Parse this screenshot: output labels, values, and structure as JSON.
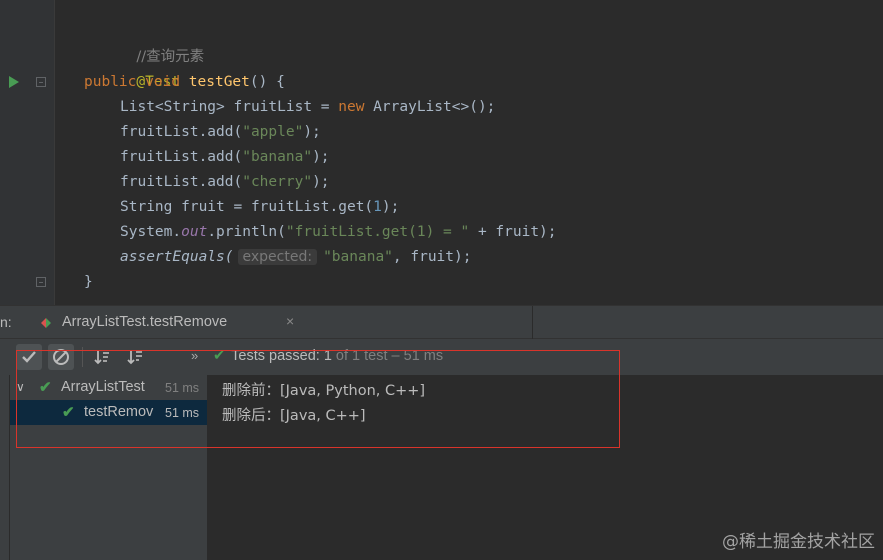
{
  "editor": {
    "comment": "//查询元素",
    "annotation": "@Test",
    "kw_public": "public",
    "kw_void": "void",
    "method_name": "testGet",
    "sig_tail": "() {",
    "l4_a": "List<String> fruitList = ",
    "kw_new": "new",
    "l4_b": " ArrayList<>();",
    "add_prefix": "fruitList.add(",
    "add_suffix": ");",
    "str_apple": "\"apple\"",
    "str_banana": "\"banana\"",
    "str_cherry": "\"cherry\"",
    "l8_a": "String fruit = fruitList.get(",
    "num_1": "1",
    "l8_b": ");",
    "sys_a": "System.",
    "sys_out": "out",
    "sys_b": ".println(",
    "str_print": "\"fruitList.get(1) = \"",
    "sys_c": " + fruit);",
    "assert_fn": "assertEquals(",
    "hint_expected": "expected:",
    "assert_tail": ", fruit);",
    "closing": "}"
  },
  "run_panel": {
    "label_prefix": "n:",
    "tab_label": "ArrayListTest.testRemove",
    "tab_close": "×",
    "toolbar_chevron": "»",
    "status_passed": "Tests passed: 1",
    "status_rest": " of 1 test – 51 ms",
    "tree": [
      {
        "name": "ArrayListTest",
        "time": "51 ms",
        "expanded": true
      },
      {
        "name": "testRemov",
        "time": "51 ms",
        "selected": true
      }
    ],
    "console_lines": [
      "删除前：[Java, Python, C++]",
      "删除后：[Java, C++]"
    ]
  },
  "watermark": "@稀土掘金技术社区",
  "colors": {
    "accent_green": "#499c54",
    "highlight_box": "#d9342b",
    "keyword": "#cc7832",
    "string": "#6a8759",
    "method": "#ffc66d"
  }
}
